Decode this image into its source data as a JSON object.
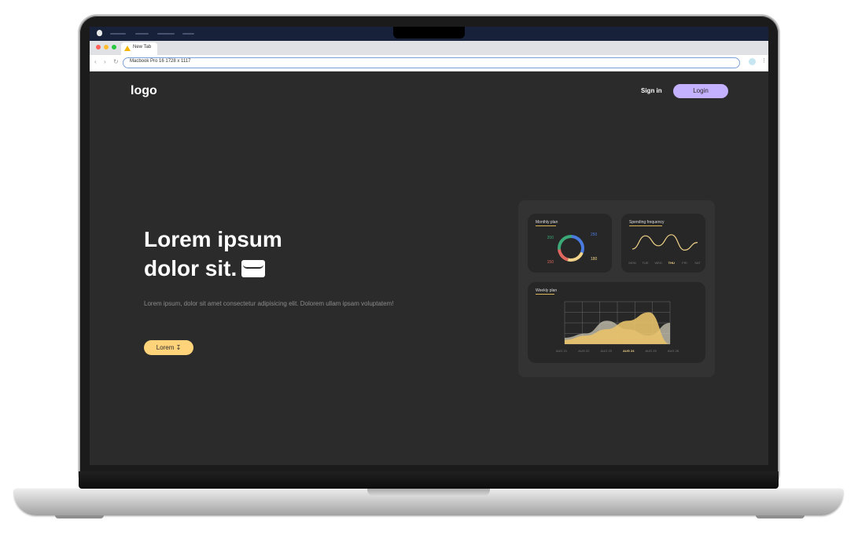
{
  "browser": {
    "tab_label": "New Tab",
    "url_text": "Macbook Pro 16  1728 x 1117"
  },
  "nav": {
    "logo": "logo",
    "sign_in": "Sign in",
    "login": "Login"
  },
  "hero": {
    "title_line1": "Lorem ipsum",
    "title_line2": "dolor sit.",
    "description": "Lorem ipsum, dolor sit amet consectetur adipisicing elit. Dolorem ullam ipsam voluptatem!",
    "cta_label": "Lorem"
  },
  "colors": {
    "background": "#2b2b2b",
    "accent_purple": "#c4b1ff",
    "accent_yellow": "#ffd37a"
  },
  "dashboard": {
    "monthly_plan_title": "Monthly plan",
    "spending_title": "Spending frequency",
    "weekly_title": "Weekly plan",
    "spending_days": [
      "MON",
      "TUE",
      "WED",
      "THU",
      "FRI",
      "SAT"
    ],
    "spending_active": "THU",
    "weekly_dates": [
      "AUG 21",
      "AUG 22",
      "AUG 23",
      "AUG 24",
      "AUG 25",
      "AUG 26"
    ],
    "weekly_active": "AUG 24"
  },
  "chart_data": [
    {
      "type": "pie",
      "title": "Monthly plan",
      "labels": [
        "250",
        "180",
        "150",
        "200"
      ],
      "values": [
        250,
        180,
        150,
        200
      ],
      "colors": [
        "#4a7be0",
        "#f1d48a",
        "#e0675e",
        "#3aa877"
      ]
    },
    {
      "type": "line",
      "title": "Spending frequency",
      "categories": [
        "MON",
        "TUE",
        "WED",
        "THU",
        "FRI",
        "SAT"
      ],
      "values": [
        0.25,
        0.85,
        0.4,
        0.9,
        0.2,
        0.55
      ],
      "color": "#f1d48a"
    },
    {
      "type": "area",
      "title": "Weekly plan",
      "categories": [
        "AUG 21",
        "AUG 22",
        "AUG 23",
        "AUG 24",
        "AUG 25",
        "AUG 26"
      ],
      "series": [
        {
          "values": [
            0.15,
            0.25,
            0.55,
            0.35,
            0.2,
            0.5
          ],
          "color": "#cfc9b6"
        },
        {
          "values": [
            0.1,
            0.2,
            0.35,
            0.55,
            0.75,
            0.0
          ],
          "color": "#e8c26a"
        }
      ],
      "grid": true
    }
  ]
}
